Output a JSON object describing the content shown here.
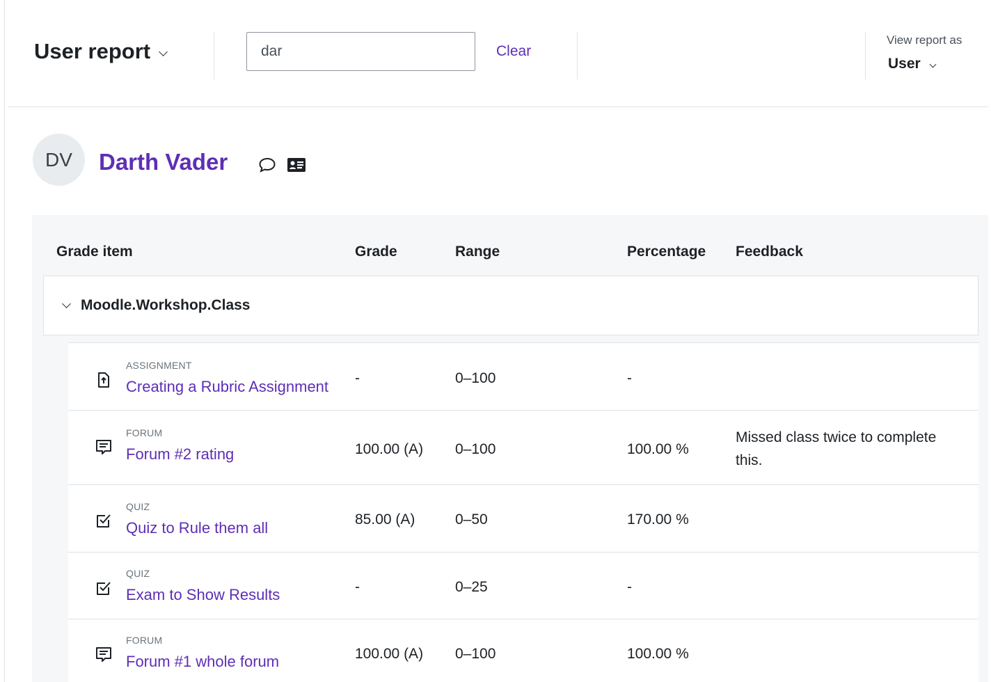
{
  "header": {
    "report_title": "User report",
    "search_value": "dar",
    "clear_label": "Clear",
    "view_as_label": "View report as",
    "view_as_value": "User"
  },
  "user": {
    "initials": "DV",
    "name": "Darth Vader"
  },
  "table": {
    "headers": {
      "grade_item": "Grade item",
      "grade": "Grade",
      "range": "Range",
      "percentage": "Percentage",
      "feedback": "Feedback"
    },
    "category": "Moodle.Workshop.Class",
    "rows": [
      {
        "kind": "ASSIGNMENT",
        "icon": "assignment-icon",
        "name": "Creating a Rubric Assignment",
        "grade": "-",
        "range": "0–100",
        "percentage": "-",
        "feedback": ""
      },
      {
        "kind": "FORUM",
        "icon": "forum-icon",
        "name": "Forum #2 rating",
        "grade": "100.00 (A)",
        "range": "0–100",
        "percentage": "100.00 %",
        "feedback": "Missed class twice to complete this."
      },
      {
        "kind": "QUIZ",
        "icon": "quiz-icon",
        "name": "Quiz to Rule them all",
        "grade": "85.00 (A)",
        "range": "0–50",
        "percentage": "170.00 %",
        "feedback": ""
      },
      {
        "kind": "QUIZ",
        "icon": "quiz-icon",
        "name": "Exam to Show Results",
        "grade": "-",
        "range": "0–25",
        "percentage": "-",
        "feedback": ""
      },
      {
        "kind": "FORUM",
        "icon": "forum-icon",
        "name": "Forum #1 whole forum",
        "grade": "100.00 (A)",
        "range": "0–100",
        "percentage": "100.00 %",
        "feedback": ""
      }
    ]
  },
  "colors": {
    "link": "#5e2eb5",
    "text": "#1d2125",
    "muted": "#6a737b",
    "border": "#dee2e6",
    "table_bg": "#f6f7f8"
  }
}
